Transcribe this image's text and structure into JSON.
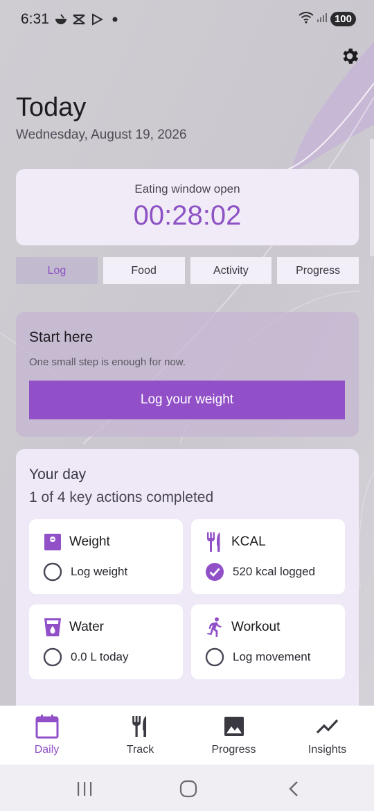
{
  "status_bar": {
    "time": "6:31",
    "battery": "100"
  },
  "header": {
    "title": "Today",
    "date": "Wednesday, August 19, 2026"
  },
  "eating_window": {
    "label": "Eating window open",
    "timer": "00:28:02"
  },
  "tabs": [
    {
      "label": "Log",
      "active": true
    },
    {
      "label": "Food",
      "active": false
    },
    {
      "label": "Activity",
      "active": false
    },
    {
      "label": "Progress",
      "active": false
    }
  ],
  "start_card": {
    "title": "Start here",
    "subtitle": "One small step is enough for now.",
    "button_label": "Log your weight"
  },
  "your_day": {
    "title": "Your day",
    "progress_text": "1 of 4 key actions completed",
    "actions": [
      {
        "title": "Weight",
        "status": "Log weight",
        "icon": "scale-icon",
        "done": false
      },
      {
        "title": "KCAL",
        "status": "520 kcal logged",
        "icon": "fork-knife-icon",
        "done": true
      },
      {
        "title": "Water",
        "status": "0.0 L today",
        "icon": "water-glass-icon",
        "done": false
      },
      {
        "title": "Workout",
        "status": "Log movement",
        "icon": "running-person-icon",
        "done": false
      }
    ]
  },
  "bottom_nav": [
    {
      "label": "Daily",
      "icon": "calendar-icon",
      "active": true
    },
    {
      "label": "Track",
      "icon": "fork-knife-icon",
      "active": false
    },
    {
      "label": "Progress",
      "icon": "image-icon",
      "active": false
    },
    {
      "label": "Insights",
      "icon": "trend-line-icon",
      "active": false
    }
  ],
  "colors": {
    "accent": "#9150c8",
    "accent_text": "#8e52c6",
    "card_bg": "#f1ebf8",
    "start_card_bg": "#c5b6d2",
    "background": "#d2d0d4"
  }
}
